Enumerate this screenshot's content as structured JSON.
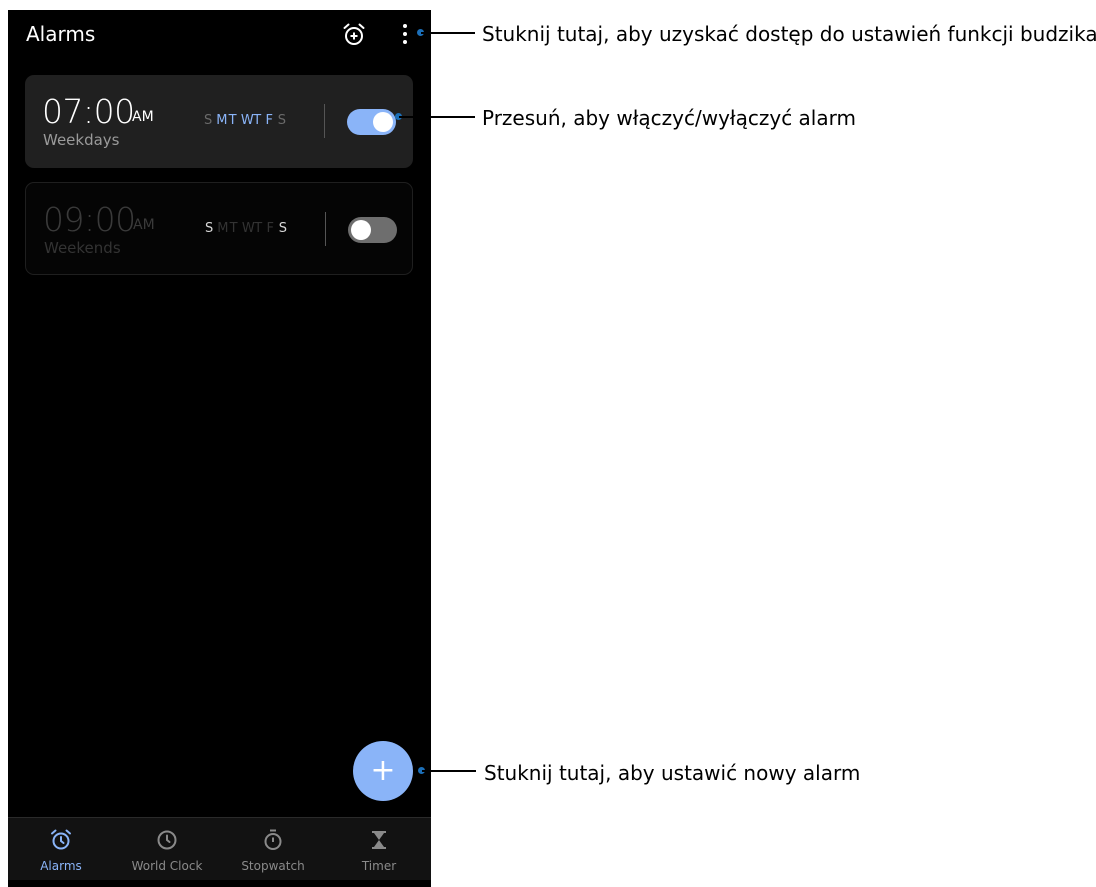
{
  "app": {
    "title": "Alarms"
  },
  "icons": {
    "add_alarm": "alarm-add-icon",
    "menu": "more-vert-icon",
    "fab": "plus-icon"
  },
  "colors": {
    "accent": "#8ab4f8",
    "background": "#000000",
    "card": "#202020"
  },
  "alarms": [
    {
      "time": "07:00",
      "ampm": "AM",
      "label": "Weekdays",
      "enabled": true,
      "days": [
        {
          "d": "S",
          "active": false
        },
        {
          "d": "M",
          "active": true
        },
        {
          "d": "T",
          "active": true
        },
        {
          "d": "W",
          "active": true
        },
        {
          "d": "T",
          "active": true
        },
        {
          "d": "F",
          "active": true
        },
        {
          "d": "S",
          "active": false
        }
      ]
    },
    {
      "time": "09:00",
      "ampm": "AM",
      "label": "Weekends",
      "enabled": false,
      "days": [
        {
          "d": "S",
          "active": true
        },
        {
          "d": "M",
          "active": false
        },
        {
          "d": "T",
          "active": false
        },
        {
          "d": "W",
          "active": false
        },
        {
          "d": "T",
          "active": false
        },
        {
          "d": "F",
          "active": false
        },
        {
          "d": "S",
          "active": true
        }
      ]
    }
  ],
  "fab": {
    "label": "+"
  },
  "nav": [
    {
      "label": "Alarms",
      "icon": "alarm-icon",
      "active": true
    },
    {
      "label": "World Clock",
      "icon": "clock-icon",
      "active": false
    },
    {
      "label": "Stopwatch",
      "icon": "stopwatch-icon",
      "active": false
    },
    {
      "label": "Timer",
      "icon": "hourglass-icon",
      "active": false
    }
  ],
  "callouts": {
    "settings": "Stuknij tutaj, aby uzyskać dostęp do ustawień funkcji budzika",
    "toggle": "Przesuń, aby włączyć/wyłączyć alarm",
    "new_alarm": "Stuknij tutaj, aby ustawić nowy alarm"
  }
}
